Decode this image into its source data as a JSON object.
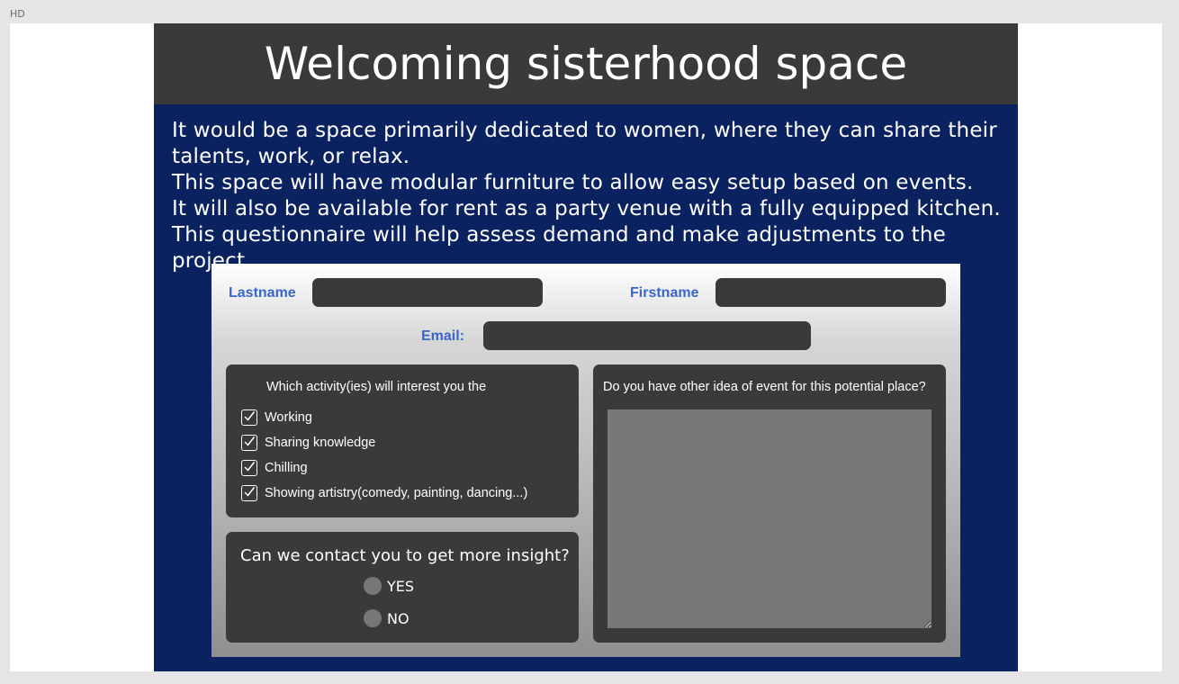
{
  "frame": {
    "label": "HD"
  },
  "header": {
    "title": "Welcoming sisterhood space"
  },
  "intro": {
    "lines": [
      "It would be a space primarily dedicated to women, where they can share their talents, work, or relax.",
      "This space will have modular furniture to allow easy setup based on events.",
      "It will also be available for rent as a party venue with a fully equipped kitchen.",
      "This questionnaire will help assess demand and make adjustments to the project."
    ]
  },
  "form": {
    "lastname_label": "Lastname",
    "lastname_value": "",
    "firstname_label": "Firstname",
    "firstname_value": "",
    "email_label": "Email:",
    "email_value": "",
    "activities": {
      "title": "Which activity(ies) will interest you the",
      "options": [
        {
          "label": "Working",
          "checked": true
        },
        {
          "label": "Sharing knowledge",
          "checked": true
        },
        {
          "label": "Chilling",
          "checked": true
        },
        {
          "label": "Showing artistry(comedy, painting, dancing...)",
          "checked": true
        }
      ]
    },
    "contact": {
      "question": "Can we contact you to get more insight?",
      "yes_label": "YES",
      "no_label": "NO"
    },
    "ideas": {
      "question": "Do you have other idea of event for this potential place?",
      "value": ""
    }
  },
  "colors": {
    "page_bg": "#0b2260",
    "header_bg": "#3a3a3c",
    "label_blue": "#3a66cc",
    "field_bg": "#3a3a3c",
    "radio_fill": "#777777"
  },
  "icons": {
    "checkbox": "checkbox-checked-icon",
    "radio": "radio-icon"
  }
}
